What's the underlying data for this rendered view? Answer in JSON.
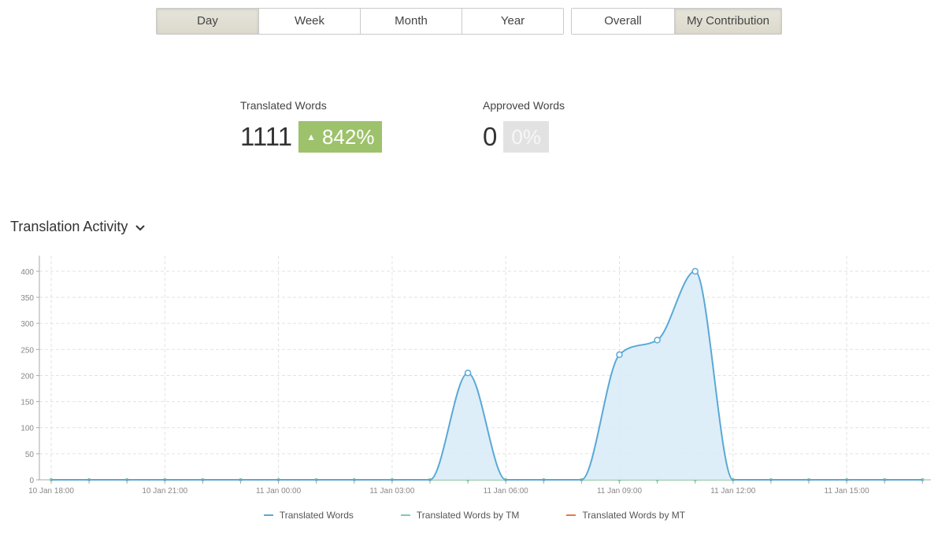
{
  "period_tabs": [
    {
      "label": "Day",
      "active": true
    },
    {
      "label": "Week",
      "active": false
    },
    {
      "label": "Month",
      "active": false
    },
    {
      "label": "Year",
      "active": false
    }
  ],
  "scope_tabs": [
    {
      "label": "Overall",
      "active": false
    },
    {
      "label": "My Contribution",
      "active": true
    }
  ],
  "stats": {
    "translated": {
      "label": "Translated Words",
      "value": "1111",
      "change": "842%",
      "trend": "up"
    },
    "approved": {
      "label": "Approved Words",
      "value": "0",
      "change": "0%",
      "trend": "none"
    }
  },
  "section": {
    "title": "Translation Activity",
    "icon": "chevron-down-icon"
  },
  "colors": {
    "translated": "#5aa8d6",
    "tm": "#7dcbb0",
    "mt": "#e07b4c",
    "area_fill": "#d9ecf7",
    "badge_up": "#9dc26b"
  },
  "chart_data": {
    "type": "area",
    "ylim": [
      0,
      430
    ],
    "yticks": [
      0,
      50,
      100,
      150,
      200,
      250,
      300,
      350,
      400
    ],
    "x_hours_start": "10 Jan 18:00",
    "x_step_hours": 1,
    "xtick_labels": [
      "10 Jan 18:00",
      "10 Jan 21:00",
      "11 Jan 00:00",
      "11 Jan 03:00",
      "11 Jan 06:00",
      "11 Jan 09:00",
      "11 Jan 12:00",
      "11 Jan 15:00"
    ],
    "series": [
      {
        "name": "Translated Words",
        "color": "#5aa8d6",
        "values": [
          0,
          0,
          0,
          0,
          0,
          0,
          0,
          0,
          0,
          0,
          0,
          205,
          0,
          0,
          0,
          240,
          268,
          400,
          0,
          0,
          0,
          0,
          0,
          0
        ]
      },
      {
        "name": "Translated Words by TM",
        "color": "#7dcbb0",
        "values": [
          0,
          0,
          0,
          0,
          0,
          0,
          0,
          0,
          0,
          0,
          0,
          0,
          0,
          0,
          0,
          0,
          0,
          0,
          0,
          0,
          0,
          0,
          0,
          0
        ]
      },
      {
        "name": "Translated Words by MT",
        "color": "#e07b4c",
        "values": [
          0,
          0,
          0,
          0,
          0,
          0,
          0,
          0,
          0,
          0,
          0,
          0,
          0,
          0,
          0,
          0,
          0,
          0,
          0,
          0,
          0,
          0,
          0,
          0
        ]
      }
    ],
    "grid": true,
    "legend": "bottom"
  }
}
